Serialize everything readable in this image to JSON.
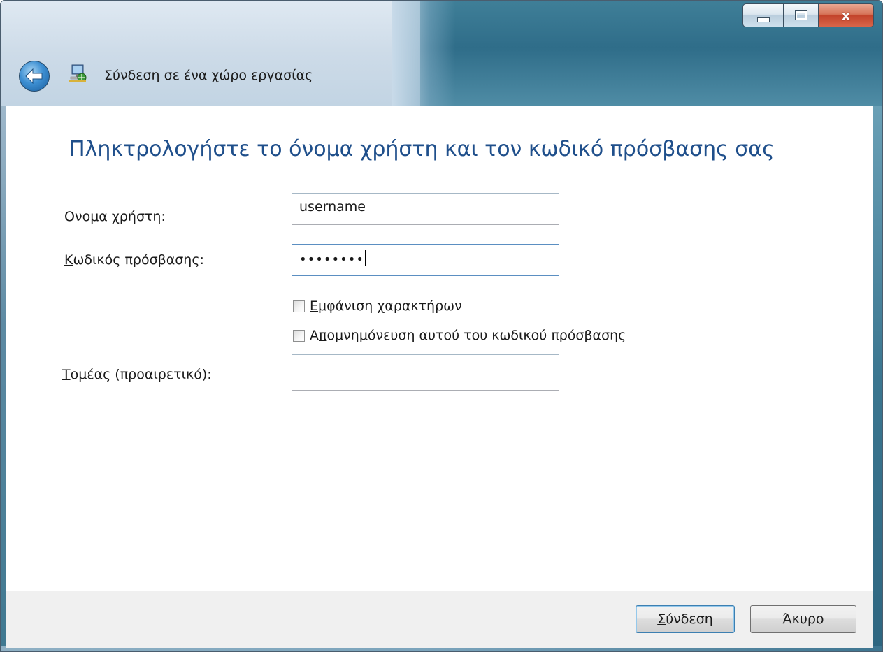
{
  "window": {
    "title": "Σύνδεση σε ένα χώρο εργασίας",
    "caption_close": "x"
  },
  "heading": "Πληκτρολογήστε το όνομα χρήστη και τον κωδικό πρόσβασης σας",
  "form": {
    "username": {
      "label_pre": "Ο",
      "label_mnemonic": "ν",
      "label_post": "ομα χρήστη:",
      "value": "username"
    },
    "password": {
      "label_mnemonic": "Κ",
      "label_post": "ωδικός πρόσβασης:",
      "masked_value": "••••••••"
    },
    "show_characters": {
      "label_mnemonic": "Ε",
      "label_post": "μφάνιση χαρακτήρων",
      "checked": false
    },
    "remember_password": {
      "label_pre": "Α",
      "label_mnemonic": "π",
      "label_post": "ομνημόνευση αυτού του κωδικού πρόσβασης",
      "checked": false
    },
    "domain": {
      "label_mnemonic": "Τ",
      "label_post": "ομέας (προαιρετικό):",
      "value": ""
    }
  },
  "buttons": {
    "connect": {
      "mnemonic": "Σ",
      "label_post": "ύνδεση"
    },
    "cancel": {
      "label": "Άκυρο"
    }
  },
  "icons": {
    "back": "back-arrow-icon",
    "app": "network-workplace-icon"
  },
  "colors": {
    "heading": "#1f4f8b",
    "default_button_border": "#3c7fb1",
    "close_button": "#c2432a"
  }
}
